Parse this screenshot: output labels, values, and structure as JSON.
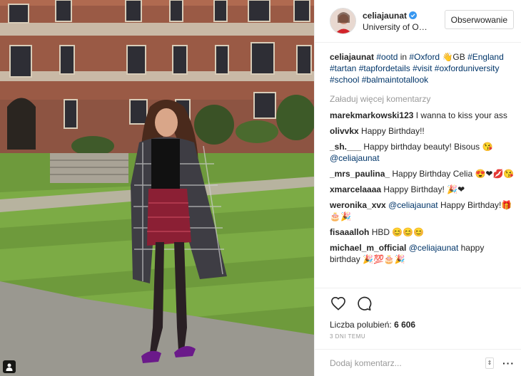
{
  "post": {
    "author": "celiajaunat",
    "location": "University of Oxford",
    "follow_label": "Obserwowanie",
    "caption_parts": [
      {
        "text": "#ootd",
        "tag": true
      },
      {
        "text": " in ",
        "tag": false
      },
      {
        "text": "#Oxford",
        "tag": true
      },
      {
        "text": " 👋GB ",
        "tag": false
      },
      {
        "text": "#England",
        "tag": true
      },
      {
        "text": " ",
        "tag": false
      },
      {
        "text": "#tartan",
        "tag": true
      },
      {
        "text": " ",
        "tag": false
      },
      {
        "text": "#tapfordetails",
        "tag": true
      },
      {
        "text": " ",
        "tag": false
      },
      {
        "text": "#visit",
        "tag": true
      },
      {
        "text": " ",
        "tag": false
      },
      {
        "text": "#oxforduniversity",
        "tag": true
      },
      {
        "text": " ",
        "tag": false
      },
      {
        "text": "#school",
        "tag": true
      },
      {
        "text": " ",
        "tag": false
      },
      {
        "text": "#balmaintotallook",
        "tag": true
      }
    ],
    "load_more": "Załaduj więcej komentarzy",
    "comments": [
      {
        "author": "marekmarkowski123",
        "parts": [
          {
            "text": "I wanna to kiss your ass",
            "tag": false
          }
        ]
      },
      {
        "author": "olivvkx",
        "parts": [
          {
            "text": "Happy Birthday!!",
            "tag": false
          }
        ]
      },
      {
        "author": "_sh.___",
        "parts": [
          {
            "text": "Happy birthday beauty! Bisous 😘 ",
            "tag": false
          },
          {
            "text": "@celiajaunat",
            "tag": true
          }
        ]
      },
      {
        "author": "_mrs_paulina_",
        "parts": [
          {
            "text": "Happy Birthday Celia 😍❤💋😘",
            "tag": false
          }
        ]
      },
      {
        "author": "xmarcelaaaa",
        "parts": [
          {
            "text": "Happy Birthday! 🎉❤",
            "tag": false
          }
        ]
      },
      {
        "author": "weronika_xvx",
        "parts": [
          {
            "text": "@celiajaunat",
            "tag": true
          },
          {
            "text": " Happy Birthday!🎁🎂🎉",
            "tag": false
          }
        ]
      },
      {
        "author": "fisaaalloh",
        "parts": [
          {
            "text": "HBD 😊😊😊",
            "tag": false
          }
        ]
      },
      {
        "author": "michael_m_official",
        "parts": [
          {
            "text": "@celiajaunat",
            "tag": true
          },
          {
            "text": " happy birthday 🎉💯🎂🎉",
            "tag": false
          }
        ]
      }
    ],
    "likes_label": "Liczba polubień:",
    "likes_count": "6 606",
    "time_ago": "3 DNI TEMU",
    "add_comment_placeholder": "Dodaj komentarz..."
  }
}
